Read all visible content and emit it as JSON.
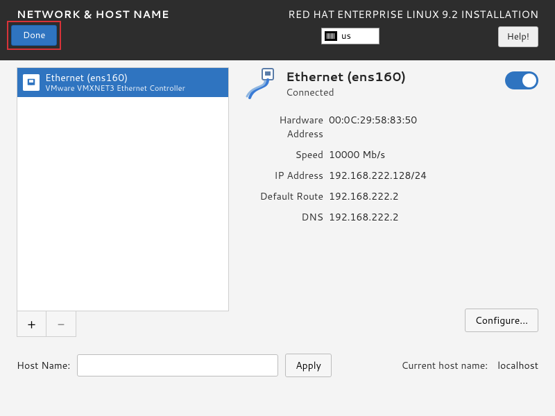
{
  "header": {
    "title_left": "NETWORK & HOST NAME",
    "title_right": "RED HAT ENTERPRISE LINUX 9.2 INSTALLATION",
    "done_label": "Done",
    "help_label": "Help!",
    "keyboard_layout": "us"
  },
  "interfaces": {
    "items": [
      {
        "name": "Ethernet (ens160)",
        "subtitle": "VMware VMXNET3 Ethernet Controller",
        "selected": true
      }
    ],
    "add_label": "+",
    "remove_label": "−"
  },
  "detail": {
    "title": "Ethernet (ens160)",
    "status": "Connected",
    "enabled": true,
    "rows": {
      "hw_label": "Hardware Address",
      "hw_value": "00:0C:29:58:83:50",
      "speed_label": "Speed",
      "speed_value": "10000 Mb/s",
      "ip_label": "IP Address",
      "ip_value": "192.168.222.128/24",
      "route_label": "Default Route",
      "route_value": "192.168.222.2",
      "dns_label": "DNS",
      "dns_value": "192.168.222.2"
    },
    "configure_label": "Configure..."
  },
  "hostname": {
    "label": "Host Name:",
    "value": "",
    "apply_label": "Apply",
    "current_label": "Current host name:",
    "current_value": "localhost"
  }
}
